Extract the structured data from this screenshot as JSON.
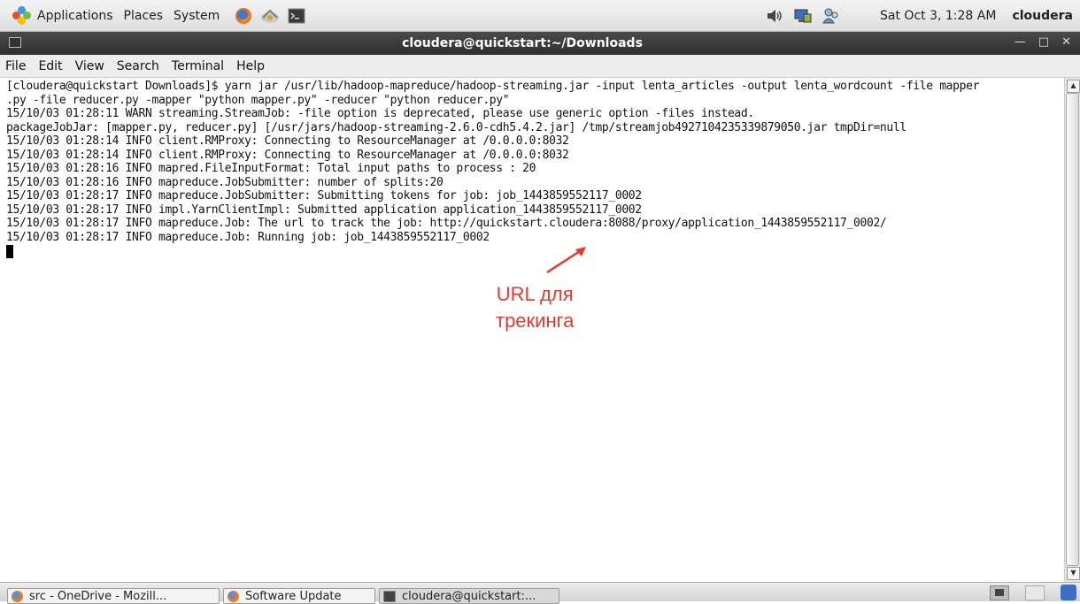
{
  "panel": {
    "menus": [
      "Applications",
      "Places",
      "System"
    ],
    "clock": "Sat Oct 3,  1:28 AM",
    "user": "cloudera"
  },
  "window": {
    "title": "cloudera@quickstart:~/Downloads"
  },
  "menubar": {
    "items": [
      "File",
      "Edit",
      "View",
      "Search",
      "Terminal",
      "Help"
    ]
  },
  "terminal": {
    "lines": [
      "[cloudera@quickstart Downloads]$ yarn jar /usr/lib/hadoop-mapreduce/hadoop-streaming.jar -input lenta_articles -output lenta_wordcount -file mapper",
      ".py -file reducer.py -mapper \"python mapper.py\" -reducer \"python reducer.py\"",
      "15/10/03 01:28:11 WARN streaming.StreamJob: -file option is deprecated, please use generic option -files instead.",
      "packageJobJar: [mapper.py, reducer.py] [/usr/jars/hadoop-streaming-2.6.0-cdh5.4.2.jar] /tmp/streamjob4927104235339879050.jar tmpDir=null",
      "15/10/03 01:28:14 INFO client.RMProxy: Connecting to ResourceManager at /0.0.0.0:8032",
      "15/10/03 01:28:14 INFO client.RMProxy: Connecting to ResourceManager at /0.0.0.0:8032",
      "15/10/03 01:28:16 INFO mapred.FileInputFormat: Total input paths to process : 20",
      "15/10/03 01:28:16 INFO mapreduce.JobSubmitter: number of splits:20",
      "15/10/03 01:28:17 INFO mapreduce.JobSubmitter: Submitting tokens for job: job_1443859552117_0002",
      "15/10/03 01:28:17 INFO impl.YarnClientImpl: Submitted application application_1443859552117_0002",
      "15/10/03 01:28:17 INFO mapreduce.Job: The url to track the job: http://quickstart.cloudera:8088/proxy/application_1443859552117_0002/",
      "15/10/03 01:28:17 INFO mapreduce.Job: Running job: job_1443859552117_0002"
    ]
  },
  "annotation": {
    "line1": "URL для",
    "line2": "трекинга",
    "color": "#e8382e"
  },
  "taskbar": {
    "tasks": [
      "src - OneDrive - Mozill...",
      "Software Update",
      "cloudera@quickstart:..."
    ]
  }
}
